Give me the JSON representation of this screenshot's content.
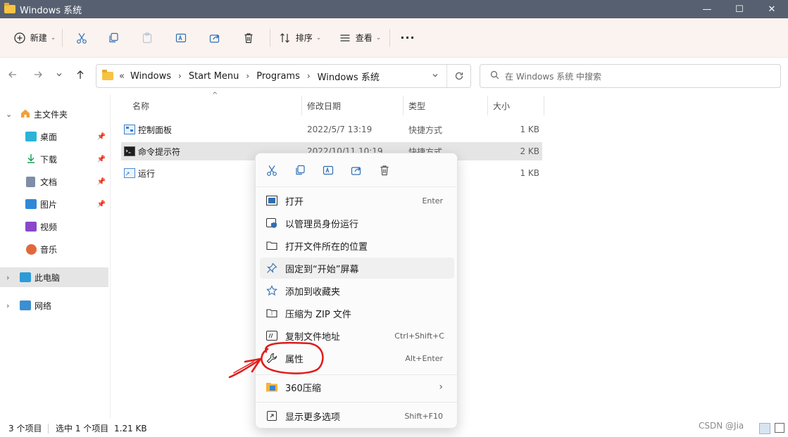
{
  "window": {
    "title": "Windows 系统",
    "controls": {
      "minimize": "—",
      "maximize": "☐",
      "close": "✕"
    }
  },
  "toolbar": {
    "new_label": "新建",
    "sort_label": "排序",
    "view_label": "查看",
    "more_label": "···"
  },
  "address": {
    "prefix": "«",
    "crumbs": [
      "Windows",
      "Start Menu",
      "Programs",
      "Windows 系统"
    ]
  },
  "search": {
    "placeholder": "在 Windows 系统 中搜索"
  },
  "sidebar": {
    "items": [
      {
        "label": "主文件夹",
        "icon": "home-icon"
      },
      {
        "label": "桌面",
        "icon": "desktop-icon",
        "pinned": true
      },
      {
        "label": "下载",
        "icon": "download-icon",
        "pinned": true
      },
      {
        "label": "文档",
        "icon": "document-icon",
        "pinned": true
      },
      {
        "label": "图片",
        "icon": "pictures-icon",
        "pinned": true
      },
      {
        "label": "视频",
        "icon": "video-icon"
      },
      {
        "label": "音乐",
        "icon": "music-icon"
      },
      {
        "label": "此电脑",
        "icon": "pc-icon"
      },
      {
        "label": "网络",
        "icon": "network-icon"
      }
    ]
  },
  "columns": {
    "name": "名称",
    "modified": "修改日期",
    "type": "类型",
    "size": "大小"
  },
  "files": [
    {
      "name": "控制面板",
      "modified": "2022/5/7 13:19",
      "type": "快捷方式",
      "size": "1 KB"
    },
    {
      "name": "命令提示符",
      "modified": "2022/10/11 10:19",
      "type": "快捷方式",
      "size": "2 KB"
    },
    {
      "name": "运行",
      "modified": "",
      "type": "",
      "size": "1 KB"
    }
  ],
  "status": {
    "count": "3 个项目",
    "selected": "选中 1 个项目",
    "size": "1.21 KB"
  },
  "context_menu": {
    "items": [
      {
        "label": "打开",
        "shortcut": "Enter",
        "icon": "open-icon"
      },
      {
        "label": "以管理员身份运行",
        "shortcut": "",
        "icon": "admin-shield-icon"
      },
      {
        "label": "打开文件所在的位置",
        "shortcut": "",
        "icon": "folder-icon"
      },
      {
        "label": "固定到“开始”屏幕",
        "shortcut": "",
        "icon": "pin-icon"
      },
      {
        "label": "添加到收藏夹",
        "shortcut": "",
        "icon": "star-icon"
      },
      {
        "label": "压缩为 ZIP 文件",
        "shortcut": "",
        "icon": "zip-icon"
      },
      {
        "label": "复制文件地址",
        "shortcut": "Ctrl+Shift+C",
        "icon": "copy-path-icon"
      },
      {
        "label": "属性",
        "shortcut": "Alt+Enter",
        "icon": "wrench-icon"
      },
      {
        "label": "360压缩",
        "shortcut": "",
        "icon": "360zip-icon"
      },
      {
        "label": "显示更多选项",
        "shortcut": "Shift+F10",
        "icon": "more-options-icon"
      }
    ]
  },
  "watermark": "CSDN @Jia"
}
